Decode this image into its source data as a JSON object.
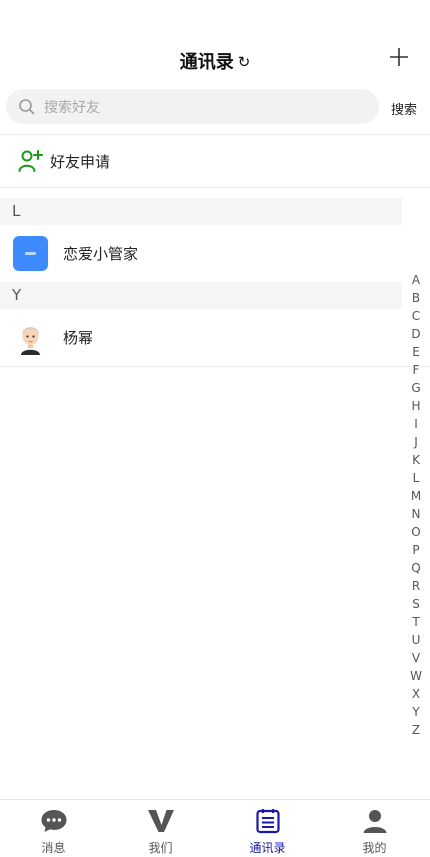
{
  "header": {
    "title": "通讯录",
    "refresh_glyph": "↻",
    "add_icon": "plus-icon"
  },
  "search": {
    "placeholder": "搜索好友",
    "value": "",
    "button_label": "搜索"
  },
  "friend_request": {
    "label": "好友申请",
    "icon": "add-user-icon",
    "color": "#1a9a1a"
  },
  "sections": [
    {
      "letter": "L",
      "contacts": [
        {
          "name": "恋爱小管家",
          "avatar": "app-logo",
          "avatar_color": "#3d8bff"
        }
      ]
    },
    {
      "letter": "Y",
      "contacts": [
        {
          "name": "杨幂",
          "avatar": "cartoon-avatar"
        }
      ]
    }
  ],
  "alphabet": [
    "A",
    "B",
    "C",
    "D",
    "E",
    "F",
    "G",
    "H",
    "I",
    "J",
    "K",
    "L",
    "M",
    "N",
    "O",
    "P",
    "Q",
    "R",
    "S",
    "T",
    "U",
    "V",
    "W",
    "X",
    "Y",
    "Z"
  ],
  "tabs": [
    {
      "label": "消息",
      "icon": "chat-bubble-icon",
      "active": false
    },
    {
      "label": "我们",
      "icon": "v-logo-icon",
      "active": false
    },
    {
      "label": "通讯录",
      "icon": "contacts-list-icon",
      "active": true
    },
    {
      "label": "我的",
      "icon": "person-icon",
      "active": false
    }
  ],
  "colors": {
    "accent": "#1a1aa6",
    "friend_green": "#1a9a1a",
    "section_bg": "#f5f5f5"
  }
}
